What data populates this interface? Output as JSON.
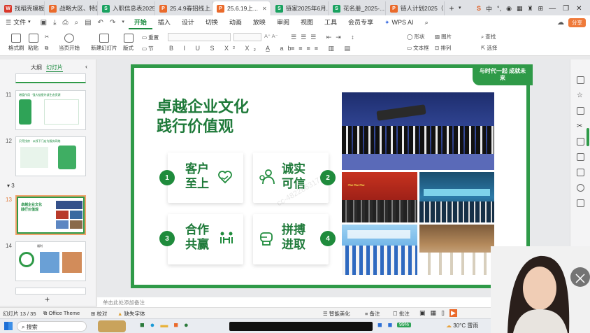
{
  "tabs": [
    {
      "label": "找稻壳模板",
      "icon": "wps-logo-icon",
      "active": false
    },
    {
      "label": "战略大区、特区支持...",
      "icon": "ppt-icon",
      "active": false
    },
    {
      "label": "入职信息表2025-0...",
      "icon": "sheet-icon",
      "active": false
    },
    {
      "label": "25.4.9春招线上...",
      "icon": "ppt-icon",
      "active": false
    },
    {
      "label": "25.6.19上...",
      "icon": "ppt-icon",
      "active": true
    },
    {
      "label": "链家2025年6月...",
      "icon": "sheet-icon",
      "active": false
    },
    {
      "label": "花名册_2025-...",
      "icon": "sheet-icon",
      "active": false
    },
    {
      "label": "链人计划2025（实...",
      "icon": "ppt-icon",
      "active": false
    }
  ],
  "menu": {
    "file": "文件",
    "items": [
      "开始",
      "插入",
      "设计",
      "切换",
      "动画",
      "放映",
      "审阅",
      "视图",
      "工具",
      "会员专享",
      "WPS AI"
    ],
    "active": "开始",
    "share": "分享"
  },
  "ribbon": {
    "format_painter": "格式刷",
    "paste": "粘贴",
    "play_from_current": "当页开始",
    "new_slide": "新建幻灯片",
    "layout": "版式",
    "reset": "重置",
    "section": "节",
    "shape": "形状",
    "picture": "图片",
    "find": "查找",
    "textbox": "文本框",
    "arrange": "排列",
    "select": "选择"
  },
  "leftpanel": {
    "tab_outline": "大纲",
    "tab_slides": "幻灯片",
    "section_label": "3",
    "slides": [
      {
        "num": "11",
        "title": "增值作用 · 强大链接外部生态资源"
      },
      {
        "num": "12",
        "title": "贝壳找房 · 以线下门店为服务网络"
      },
      {
        "num": "13",
        "title": "卓越企业文化 践行价值观",
        "selected": true
      },
      {
        "num": "14",
        "title": "福利"
      }
    ]
  },
  "slide": {
    "title_line1": "卓越企业文化",
    "title_line2": "践行价值观",
    "badge": "与时代一起 成就未来",
    "values": [
      {
        "num": "1",
        "line1": "客户",
        "line2": "至上",
        "icon": "heart-handshake-icon"
      },
      {
        "num": "2",
        "line1": "诚实",
        "line2": "可信",
        "icon": "people-icon"
      },
      {
        "num": "3",
        "line1": "合作",
        "line2": "共赢",
        "icon": "cooperation-icon"
      },
      {
        "num": "4",
        "line1": "拼搏",
        "line2": "进取",
        "icon": "fist-icon"
      }
    ],
    "watermark": "cc-4822863173"
  },
  "notes_placeholder": "单击此处添加备注",
  "status": {
    "slide_count": "幻灯片 13 / 35",
    "theme": "Office Theme",
    "proofread": "校对",
    "missing_font": "缺失字体",
    "smart_beautify": "智能美化",
    "notes": "备注",
    "comments": "批注"
  },
  "taskbar": {
    "search": "搜索",
    "weather": "30°C 雷雨",
    "battery": "99%"
  },
  "colors": {
    "accent": "#1a8a3e",
    "slide_border": "#2f9a48",
    "badge_circle": "#1f8b3c"
  }
}
